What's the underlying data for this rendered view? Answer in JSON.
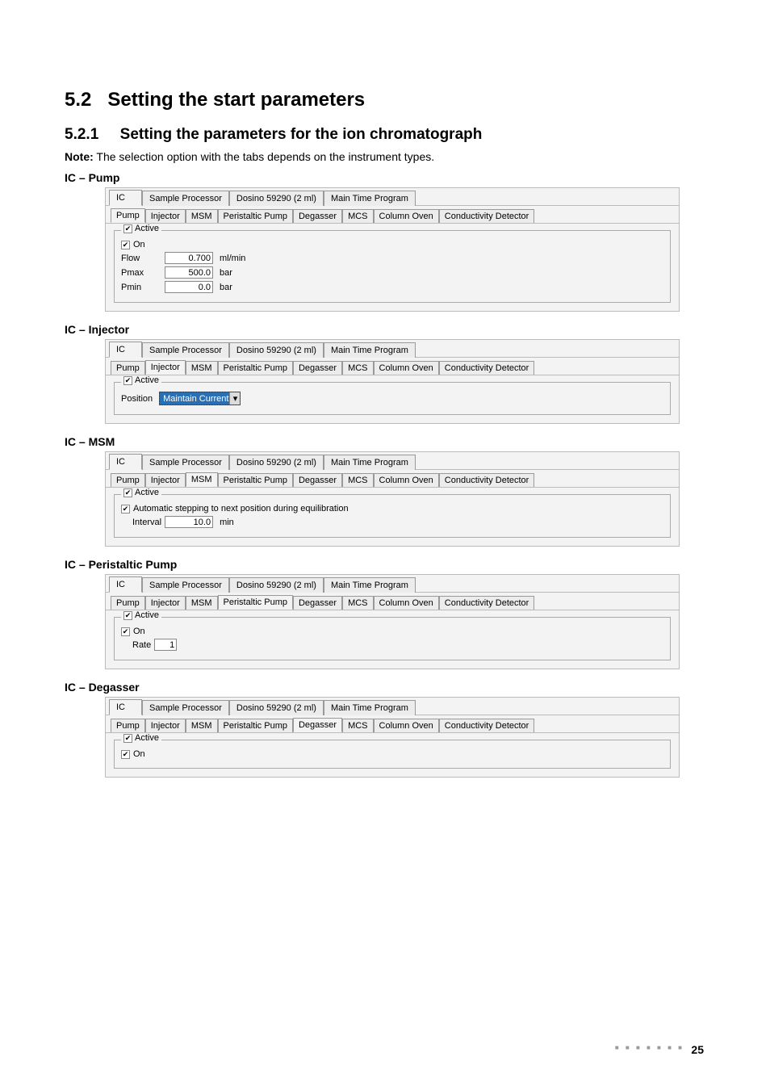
{
  "section": {
    "number": "5.2",
    "title": "Setting the start parameters"
  },
  "subsection": {
    "number": "5.2.1",
    "title": "Setting the parameters for the ion chromatograph"
  },
  "note_label": "Note:",
  "note_text": " The selection option with the tabs depends on the instrument types.",
  "top_tabs": [
    "IC",
    "Sample Processor",
    "Dosino 59290 (2 ml)",
    "Main Time Program"
  ],
  "sub_tabs": [
    "Pump",
    "Injector",
    "MSM",
    "Peristaltic Pump",
    "Degasser",
    "MCS",
    "Column Oven",
    "Conductivity Detector"
  ],
  "panels": {
    "pump": {
      "label": "IC – Pump",
      "active_legend": "Active",
      "on": "On",
      "fields": {
        "flow": {
          "label": "Flow",
          "value": "0.700",
          "unit": "ml/min"
        },
        "pmax": {
          "label": "Pmax",
          "value": "500.0",
          "unit": "bar"
        },
        "pmin": {
          "label": "Pmin",
          "value": "0.0",
          "unit": "bar"
        }
      }
    },
    "injector": {
      "label": "IC – Injector",
      "active_legend": "Active",
      "position_label": "Position",
      "position_value": "Maintain Current"
    },
    "msm": {
      "label": "IC – MSM",
      "active_legend": "Active",
      "auto_step": "Automatic stepping to next position during equilibration",
      "interval_label": "Interval",
      "interval_value": "10.0",
      "interval_unit": "min"
    },
    "peristaltic": {
      "label": "IC – Peristaltic Pump",
      "active_legend": "Active",
      "on": "On",
      "rate_label": "Rate",
      "rate_value": "1"
    },
    "degasser": {
      "label": "IC – Degasser",
      "active_legend": "Active",
      "on": "On"
    }
  },
  "page_number": "25",
  "dots": "■ ■ ■ ■ ■ ■ ■"
}
